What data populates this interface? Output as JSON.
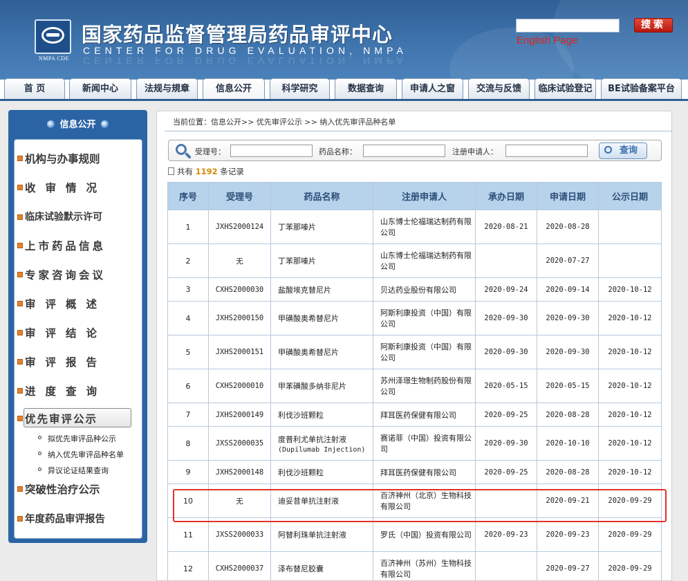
{
  "header": {
    "title": "国家药品监督管理局药品审评中心",
    "subtitle": "CENTER FOR DRUG EVALUATION, NMPA",
    "logo_text": "NMPA CDE",
    "search_button": "搜索",
    "english_link": "English Page",
    "search_value": ""
  },
  "nav": {
    "tabs": [
      "首 页",
      "新闻中心",
      "法规与規章",
      "信息公开",
      "科学研究",
      "数据查询",
      "申请人之窗",
      "交流与反馈",
      "临床试验登记",
      "BE试验备案平台"
    ],
    "active": "信息公开"
  },
  "sidebar": {
    "heading": "信息公开",
    "items": [
      "机构与办事规则",
      "收审情况",
      "临床试验默示许可",
      "上市药品信息",
      "专家咨询会议",
      "审评概述",
      "审评结论",
      "审评报告",
      "进度查询",
      "优先审评公示",
      "突破性治疗公示",
      "年度药品审评报告"
    ],
    "selected": "优先审评公示",
    "subitems": [
      "拟优先审评品种公示",
      "纳入优先审评品种名单",
      "异议论证结果查询"
    ]
  },
  "main": {
    "breadcrumb": "当前位置：信息公开>> 优先审评公示 >> 纳入优先审评品种名单",
    "search": {
      "field1_label": "受理号：",
      "field2_label": "药品名称：",
      "field3_label": "注册申请人：",
      "field1_value": "",
      "field2_value": "",
      "field3_value": "",
      "button": "查询"
    },
    "records_prefix": "共有",
    "records_count": "1192",
    "records_suffix": "条记录",
    "columns": [
      "序号",
      "受理号",
      "药品名称",
      "注册申请人",
      "承办日期",
      "申请日期",
      "公示日期"
    ],
    "rows": [
      {
        "no": "1",
        "accept": "JXHS2000124",
        "drug": "丁苯那嗪片",
        "drug_en": "",
        "applicant": "山东博士伦福瑞达制药有限公司",
        "undertake": "2020-08-21",
        "apply": "2020-08-28",
        "publish": ""
      },
      {
        "no": "2",
        "accept": "无",
        "drug": "丁苯那嗪片",
        "drug_en": "",
        "applicant": "山东博士伦福瑞达制药有限公司",
        "undertake": "",
        "apply": "2020-07-27",
        "publish": ""
      },
      {
        "no": "3",
        "accept": "CXHS2000030",
        "drug": "盐酸埃克替尼片",
        "drug_en": "",
        "applicant": "贝达药业股份有限公司",
        "undertake": "2020-09-24",
        "apply": "2020-09-14",
        "publish": "2020-10-12"
      },
      {
        "no": "4",
        "accept": "JXHS2000150",
        "drug": "甲磺酸奥希替尼片",
        "drug_en": "",
        "applicant": "阿斯利康投资（中国）有限公司",
        "undertake": "2020-09-30",
        "apply": "2020-09-30",
        "publish": "2020-10-12"
      },
      {
        "no": "5",
        "accept": "JXHS2000151",
        "drug": "甲磺酸奥希替尼片",
        "drug_en": "",
        "applicant": "阿斯利康投资（中国）有限公司",
        "undertake": "2020-09-30",
        "apply": "2020-09-30",
        "publish": "2020-10-12"
      },
      {
        "no": "6",
        "accept": "CXHS2000010",
        "drug": "甲苯磺酸多纳非尼片",
        "drug_en": "",
        "applicant": "苏州泽璟生物制药股份有限公司",
        "undertake": "2020-05-15",
        "apply": "2020-05-15",
        "publish": "2020-10-12"
      },
      {
        "no": "7",
        "accept": "JXHS2000149",
        "drug": "利伐沙班颗粒",
        "drug_en": "",
        "applicant": "拜耳医药保健有限公司",
        "undertake": "2020-09-25",
        "apply": "2020-08-28",
        "publish": "2020-10-12"
      },
      {
        "no": "8",
        "accept": "JXSS2000035",
        "drug": "度普利尤单抗注射液",
        "drug_en": "(Dupilumab Injection)",
        "applicant": "赛诺菲（中国）投资有限公司",
        "undertake": "2020-09-30",
        "apply": "2020-10-10",
        "publish": "2020-10-12"
      },
      {
        "no": "9",
        "accept": "JXHS2000148",
        "drug": "利伐沙班颗粒",
        "drug_en": "",
        "applicant": "拜耳医药保健有限公司",
        "undertake": "2020-09-25",
        "apply": "2020-08-28",
        "publish": "2020-10-12"
      },
      {
        "no": "10",
        "accept": "无",
        "drug": "迪妥昔单抗注射液",
        "drug_en": "",
        "applicant": "百济神州（北京）生物科技有限公司",
        "undertake": "",
        "apply": "2020-09-21",
        "publish": "2020-09-29"
      },
      {
        "no": "11",
        "accept": "JXSS2000033",
        "drug": "阿替利珠单抗注射液",
        "drug_en": "",
        "applicant": "罗氏（中国）投资有限公司",
        "undertake": "2020-09-23",
        "apply": "2020-09-23",
        "publish": "2020-09-29"
      },
      {
        "no": "12",
        "accept": "CXHS2000037",
        "drug": "泽布替尼胶囊",
        "drug_en": "",
        "applicant": "百济神州（苏州）生物科技有限公司",
        "undertake": "",
        "apply": "2020-09-27",
        "publish": "2020-09-29"
      }
    ],
    "highlighted_row": "10"
  },
  "colors": {
    "header_blue": "#3f74ad",
    "sidebar_blue": "#2b64a5",
    "table_header": "#b7d2eb",
    "highlight_red": "#e0322a",
    "search_red": "#d8261b"
  }
}
